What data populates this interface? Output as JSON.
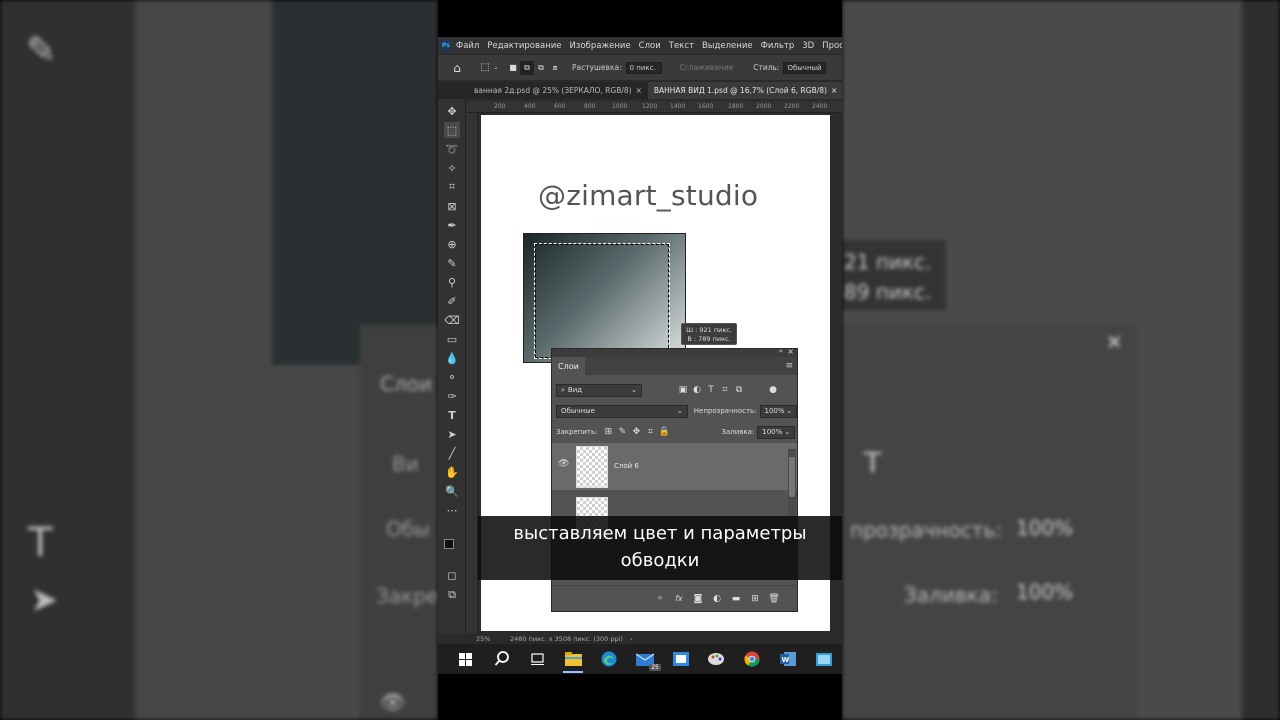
{
  "menu": {
    "items": [
      "Файл",
      "Редактирование",
      "Изображение",
      "Слои",
      "Текст",
      "Выделение",
      "Фильтр",
      "3D",
      "Просмотр"
    ]
  },
  "options": {
    "feather_label": "Растушевка:",
    "feather_value": "0 пикс.",
    "antialias_label": "Сглаживание",
    "style_label": "Стиль:",
    "style_value": "Обычный"
  },
  "tabs": [
    {
      "label": "ванная 2д.psd @ 25% (ЗЕРКАЛО, RGB/8)",
      "close": "×"
    },
    {
      "label": "ВАННАЯ ВИД 1.psd @ 16,7% (Слой 6, RGB/8)",
      "close": "×"
    }
  ],
  "ruler": {
    "ticks": [
      "200",
      "400",
      "600",
      "800",
      "1000",
      "1200",
      "1400",
      "1600",
      "1800",
      "2000",
      "2200",
      "2400"
    ]
  },
  "canvas": {
    "watermark": "@zimart_studio"
  },
  "tooltip": {
    "width": "Ш : 921 пикс.",
    "height": "В : 789 пикс."
  },
  "layers_panel": {
    "collapse": "«",
    "close": "×",
    "title": "Слои",
    "filter_value": "Вид",
    "blend_mode": "Обычные",
    "opacity_label": "Непрозрачность:",
    "opacity_value": "100%",
    "lock_label": "Закрепить:",
    "fill_label": "Заливка:",
    "fill_value": "100%",
    "layers": [
      {
        "name": "Слой 6"
      }
    ]
  },
  "status": {
    "zoom": "25%",
    "doc_info": "2480 пикс. x 3508 пикс. (300 ppi)"
  },
  "subtitle": {
    "line1": "выставляем цвет и параметры",
    "line2": "обводки"
  },
  "taskbar": {
    "mail_badge": "25"
  },
  "background_right": {
    "w": "21 пикс.",
    "h": "89 пикс.",
    "opacity": "прозрачность:",
    "opacity_value": "100%",
    "fill": "Заливка:",
    "fill_value": "100%"
  },
  "background_left": {
    "layers": "Слои",
    "view": "Ви",
    "blend": "Обы",
    "lock": "Закре"
  },
  "colors": {
    "ps_dark": "#2b2b2b",
    "panel": "#535353",
    "accent": "#31a8ff"
  }
}
